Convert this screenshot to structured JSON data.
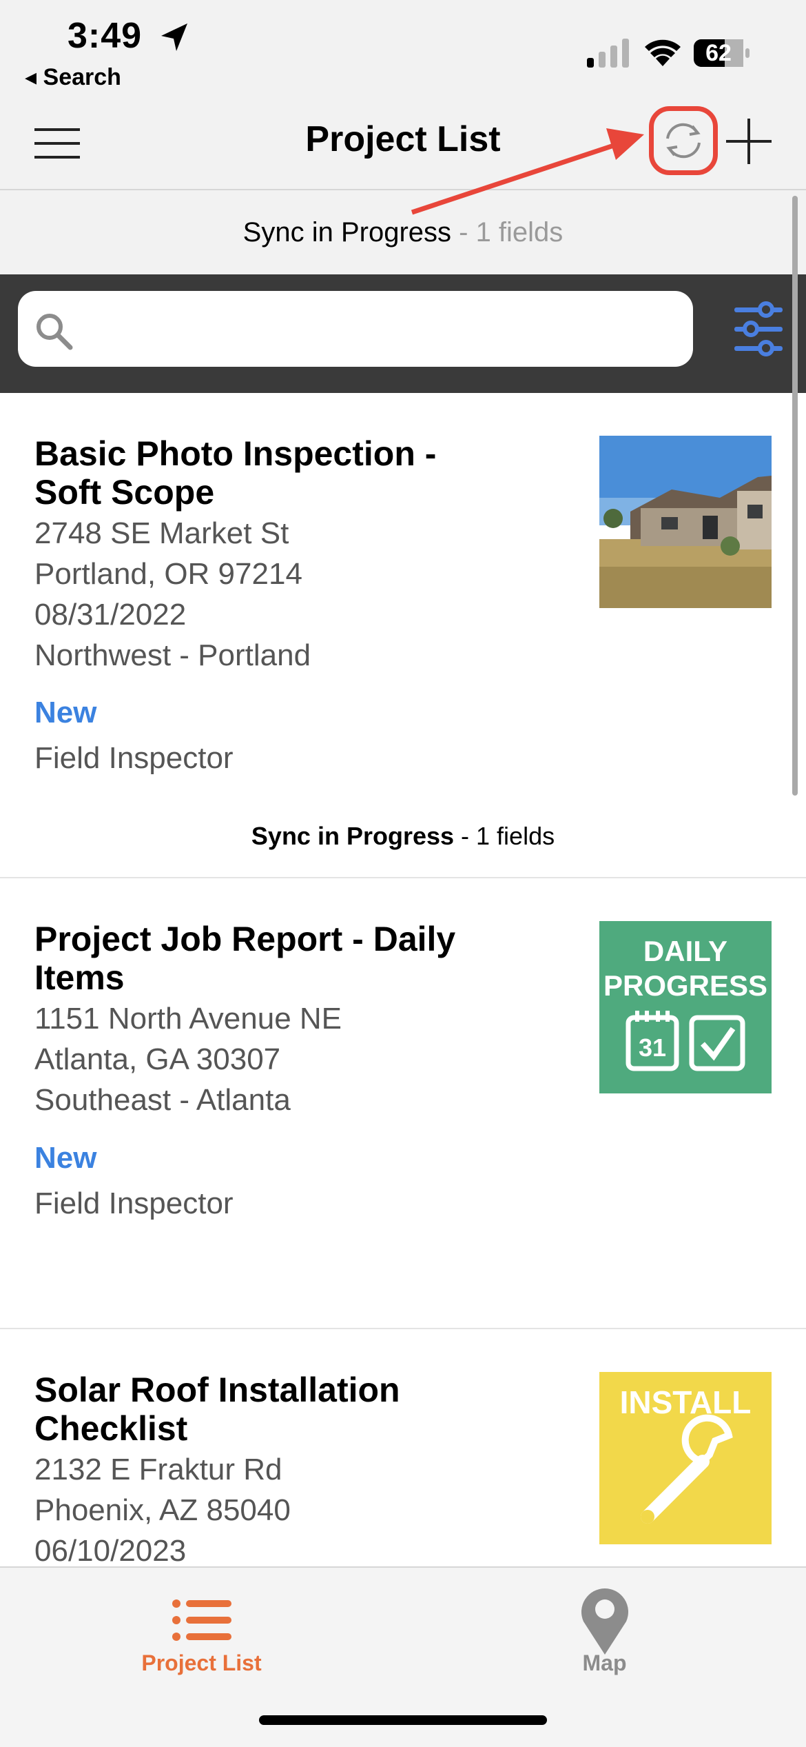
{
  "status_bar": {
    "time": "3:49",
    "back_label": "◂ Search",
    "battery": "62"
  },
  "nav": {
    "title": "Project List"
  },
  "sync_banner": {
    "bold": "Sync in Progress",
    "detail": " - 1 fields"
  },
  "search": {
    "placeholder": ""
  },
  "projects": [
    {
      "title": "Basic Photo Inspection - Soft Scope",
      "address": "2748 SE Market St",
      "city": "Portland, OR 97214",
      "date": "08/31/2022",
      "region": "Northwest - Portland",
      "status": "New",
      "role": "Field Inspector",
      "sync_bold": "Sync in Progress",
      "sync_detail": " - 1 fields",
      "thumb": "house-photo"
    },
    {
      "title": "Project Job Report - Daily Items",
      "address": "1151 North Avenue NE",
      "city": "Atlanta, GA 30307",
      "region": "Southeast - Atlanta",
      "status": "New",
      "role": "Field Inspector",
      "thumb_line1": "DAILY",
      "thumb_line2": "PROGRESS",
      "thumb_calendar_day": "31"
    },
    {
      "title": "Solar Roof Installation Checklist",
      "address": "2132 E Fraktur Rd",
      "city": "Phoenix, AZ 85040",
      "date": "06/10/2023",
      "thumb_line1": "INSTALL"
    }
  ],
  "tabs": [
    {
      "label": "Project List",
      "icon": "list-icon",
      "active": true
    },
    {
      "label": "Map",
      "icon": "map-pin-icon",
      "active": false
    }
  ],
  "colors": {
    "accent_orange": "#e8703a",
    "status_blue": "#3b82e0",
    "annotation_red": "#e8463a",
    "daily_green": "#4faa7e",
    "install_yellow": "#f2d84a",
    "filter_blue": "#4a7fe0"
  }
}
